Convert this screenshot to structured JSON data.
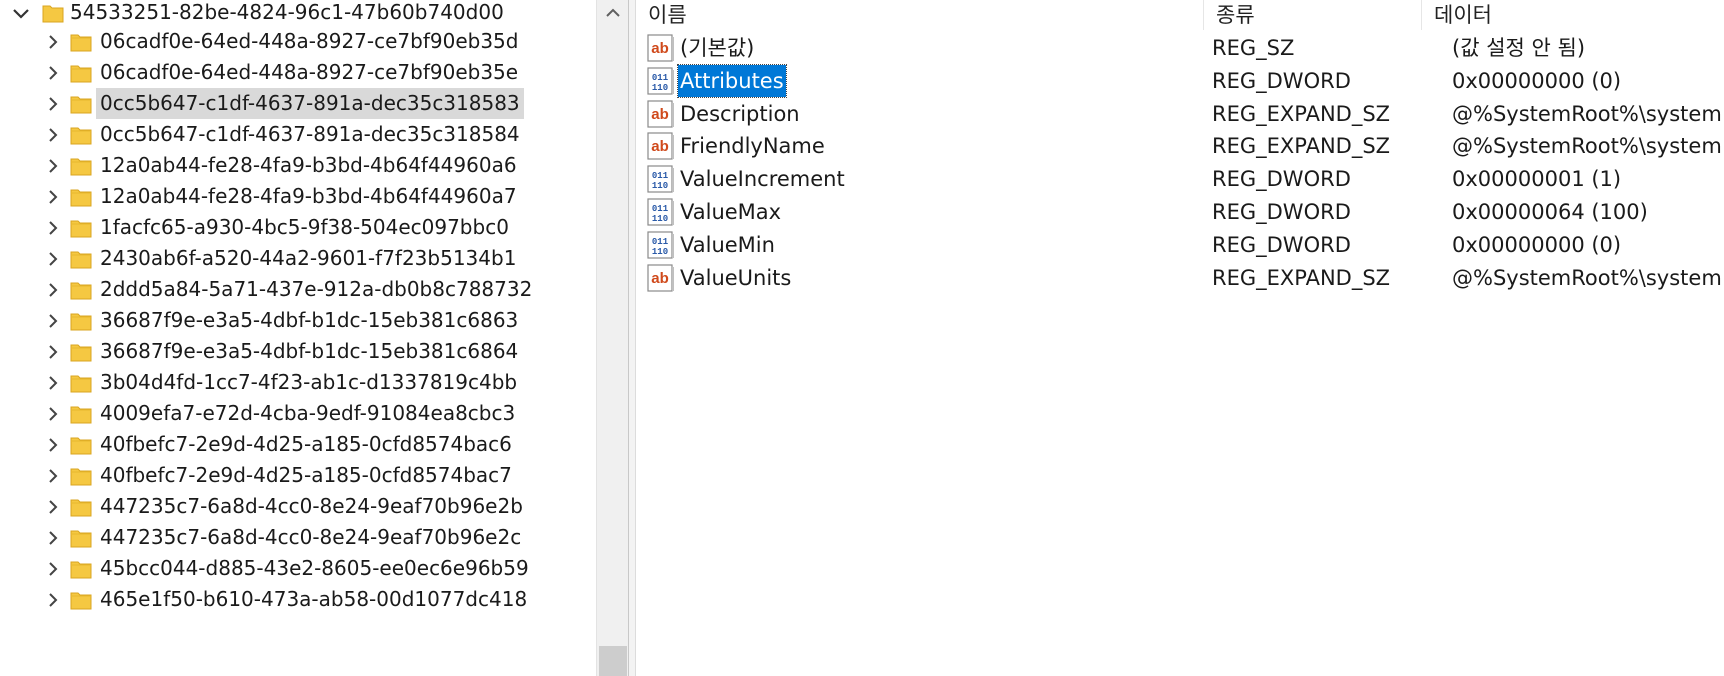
{
  "tree": {
    "root": {
      "label": "54533251-82be-4824-96c1-47b60b740d00",
      "icon": "folder-icon"
    },
    "items": [
      {
        "label": "06cadf0e-64ed-448a-8927-ce7bf90eb35d"
      },
      {
        "label": "06cadf0e-64ed-448a-8927-ce7bf90eb35e"
      },
      {
        "label": "0cc5b647-c1df-4637-891a-dec35c318583",
        "selected": true
      },
      {
        "label": "0cc5b647-c1df-4637-891a-dec35c318584"
      },
      {
        "label": "12a0ab44-fe28-4fa9-b3bd-4b64f44960a6"
      },
      {
        "label": "12a0ab44-fe28-4fa9-b3bd-4b64f44960a7"
      },
      {
        "label": "1facfc65-a930-4bc5-9f38-504ec097bbc0"
      },
      {
        "label": "2430ab6f-a520-44a2-9601-f7f23b5134b1"
      },
      {
        "label": "2ddd5a84-5a71-437e-912a-db0b8c788732"
      },
      {
        "label": "36687f9e-e3a5-4dbf-b1dc-15eb381c6863"
      },
      {
        "label": "36687f9e-e3a5-4dbf-b1dc-15eb381c6864"
      },
      {
        "label": "3b04d4fd-1cc7-4f23-ab1c-d1337819c4bb"
      },
      {
        "label": "4009efa7-e72d-4cba-9edf-91084ea8cbc3"
      },
      {
        "label": "40fbefc7-2e9d-4d25-a185-0cfd8574bac6"
      },
      {
        "label": "40fbefc7-2e9d-4d25-a185-0cfd8574bac7"
      },
      {
        "label": "447235c7-6a8d-4cc0-8e24-9eaf70b96e2b"
      },
      {
        "label": "447235c7-6a8d-4cc0-8e24-9eaf70b96e2c"
      },
      {
        "label": "45bcc044-d885-43e2-8605-ee0ec6e96b59"
      },
      {
        "label": "465e1f50-b610-473a-ab58-00d1077dc418"
      }
    ]
  },
  "values_pane": {
    "headers": {
      "name": "이름",
      "type": "종류",
      "data": "데이터"
    },
    "rows": [
      {
        "name": "(기본값)",
        "type": "REG_SZ",
        "data": "(값 설정 안 됨)",
        "icon": "string-value-icon"
      },
      {
        "name": "Attributes",
        "type": "REG_DWORD",
        "data": "0x00000000 (0)",
        "icon": "binary-value-icon",
        "selected": true
      },
      {
        "name": "Description",
        "type": "REG_EXPAND_SZ",
        "data": "@%SystemRoot%\\system",
        "icon": "string-value-icon"
      },
      {
        "name": "FriendlyName",
        "type": "REG_EXPAND_SZ",
        "data": "@%SystemRoot%\\system",
        "icon": "string-value-icon"
      },
      {
        "name": "ValueIncrement",
        "type": "REG_DWORD",
        "data": "0x00000001 (1)",
        "icon": "binary-value-icon"
      },
      {
        "name": "ValueMax",
        "type": "REG_DWORD",
        "data": "0x00000064 (100)",
        "icon": "binary-value-icon"
      },
      {
        "name": "ValueMin",
        "type": "REG_DWORD",
        "data": "0x00000000 (0)",
        "icon": "binary-value-icon"
      },
      {
        "name": "ValueUnits",
        "type": "REG_EXPAND_SZ",
        "data": "@%SystemRoot%\\system",
        "icon": "string-value-icon"
      }
    ]
  },
  "colors": {
    "selection_blue": "#0078d7",
    "tree_selection_gray": "#d9d9d9",
    "folder_yellow": "#f5c842",
    "string_icon_red": "#d04a1c",
    "binary_icon_blue": "#2a5aa8"
  }
}
